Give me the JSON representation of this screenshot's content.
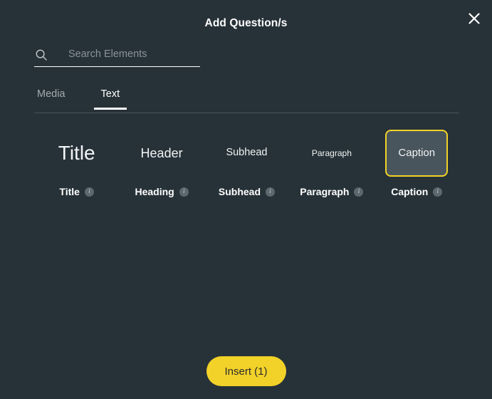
{
  "modal": {
    "title": "Add Question/s",
    "close_icon": "close-icon",
    "accent_color": "#f2d229",
    "background_color": "#273238",
    "selected_card_background": "#49555c"
  },
  "search": {
    "icon": "search-icon",
    "placeholder": "Search Elements",
    "value": ""
  },
  "tabs": [
    {
      "label": "Media",
      "active": false
    },
    {
      "label": "Text",
      "active": true
    }
  ],
  "elements": [
    {
      "preview": "Title",
      "label": "Title",
      "size_class": "sz-title",
      "selected": false,
      "info_icon": "info-icon"
    },
    {
      "preview": "Header",
      "label": "Heading",
      "size_class": "sz-header",
      "selected": false,
      "info_icon": "info-icon"
    },
    {
      "preview": "Subhead",
      "label": "Subhead",
      "size_class": "sz-subhead",
      "selected": false,
      "info_icon": "info-icon"
    },
    {
      "preview": "Paragraph",
      "label": "Paragraph",
      "size_class": "sz-paragraph",
      "selected": false,
      "info_icon": "info-icon"
    },
    {
      "preview": "Caption",
      "label": "Caption",
      "size_class": "sz-caption",
      "selected": true,
      "info_icon": "info-icon"
    }
  ],
  "footer": {
    "insert_label": "Insert (1)",
    "selected_count": 1
  }
}
